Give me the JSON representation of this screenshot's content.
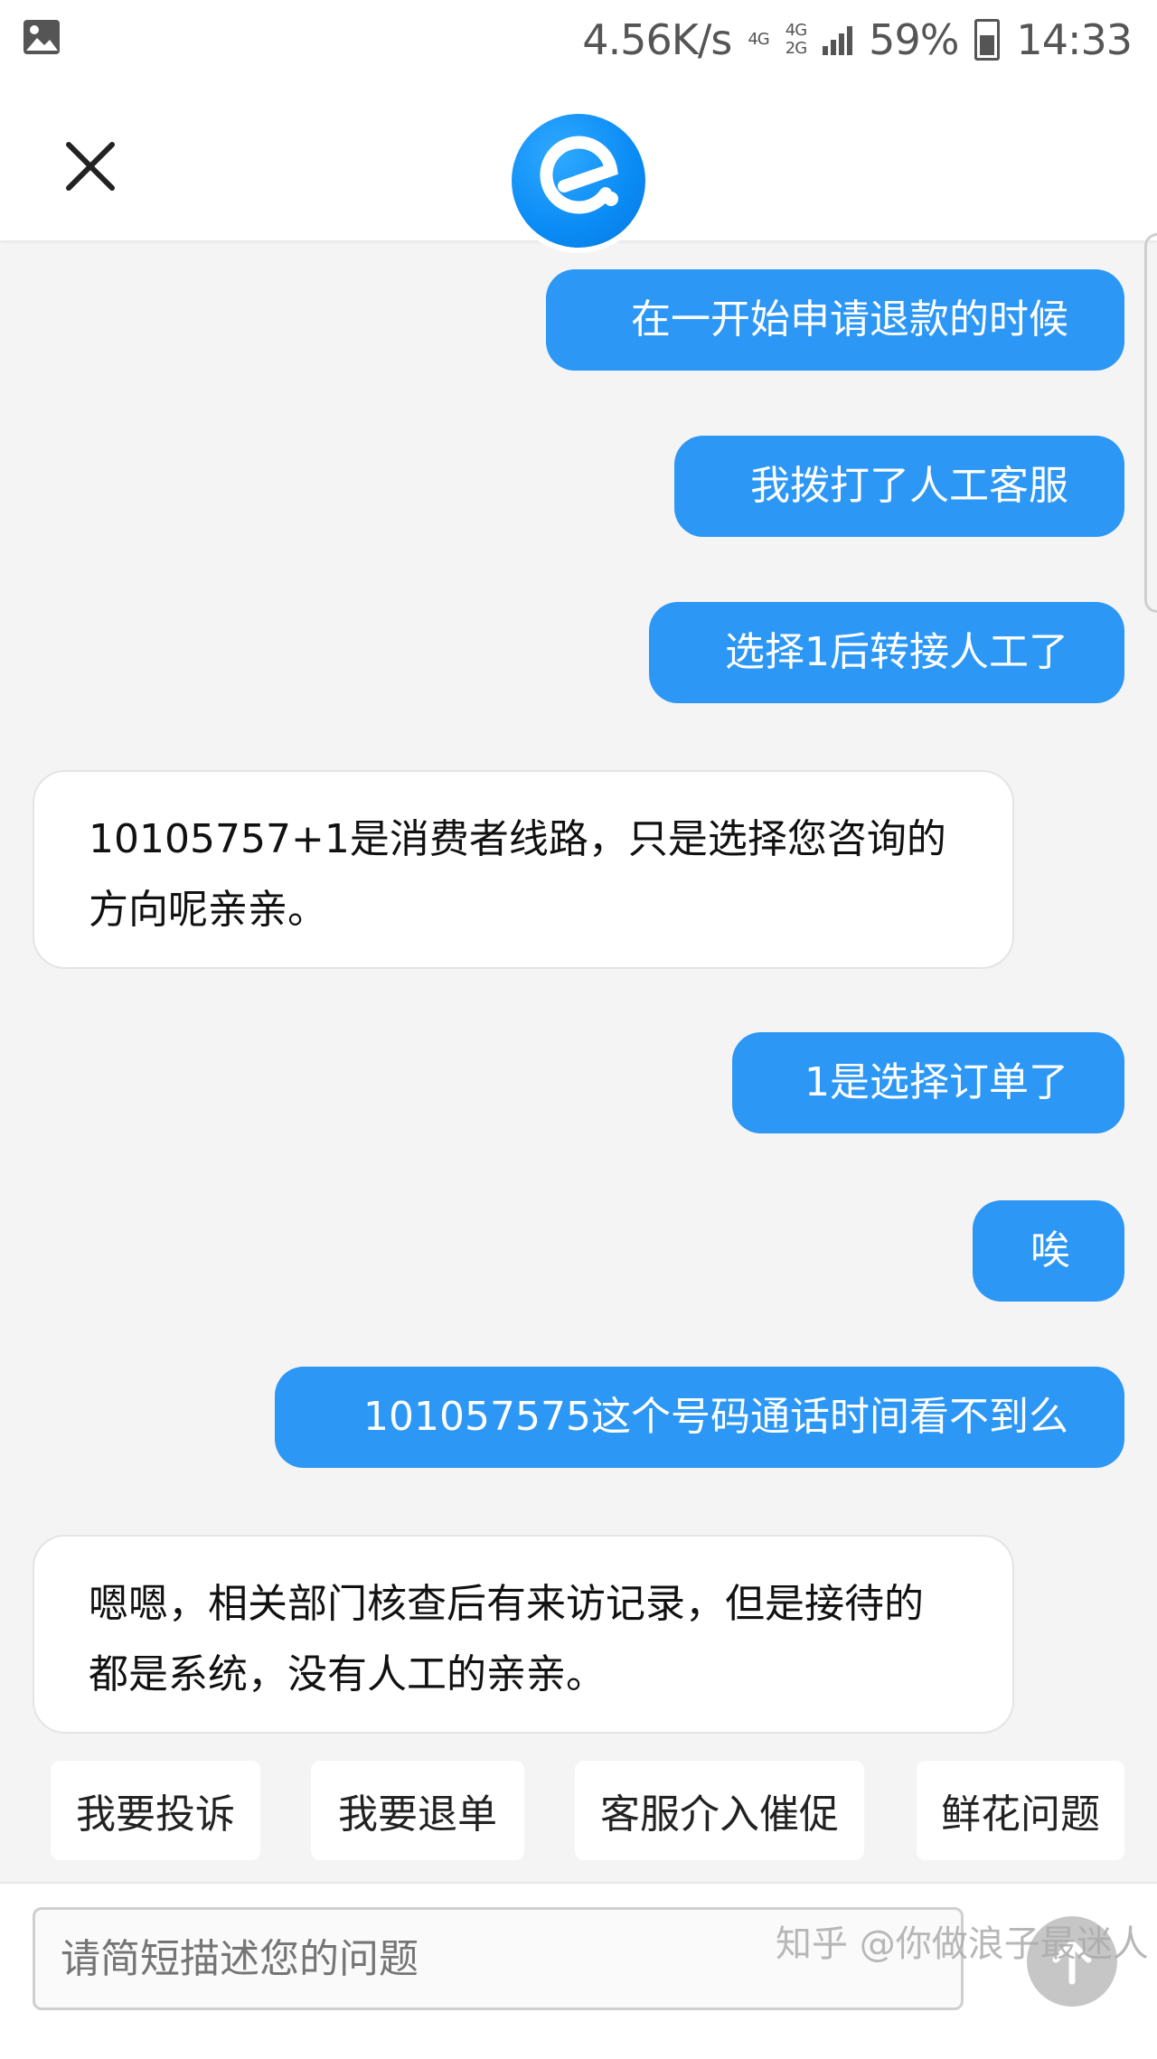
{
  "status_bar": {
    "speed": "4.56K/s",
    "net_top": "4G",
    "net_mid": "4G",
    "net_bottom": "2G",
    "battery": "59%",
    "time": "14:33",
    "left_icon": "image-icon"
  },
  "header": {
    "close_icon": "close-icon",
    "logo_icon": "eleme-logo-icon"
  },
  "messages": [
    {
      "side": "out",
      "text": "在一开始申请退款的时候"
    },
    {
      "side": "out",
      "text": "我拨打了人工客服"
    },
    {
      "side": "out",
      "text": "选择1后转接人工了"
    },
    {
      "side": "in",
      "text": "10105757+1是消费者线路，只是选择您咨询的方向呢亲亲。"
    },
    {
      "side": "out",
      "text": "1是选择订单了"
    },
    {
      "side": "out",
      "text": "唉"
    },
    {
      "side": "out",
      "text": "101057575这个号码通话时间看不到么"
    },
    {
      "side": "in",
      "text": "嗯嗯，相关部门核查后有来访记录，但是接待的都是系统，没有人工的亲亲。"
    }
  ],
  "quick_replies": [
    "我要投诉",
    "我要退单",
    "客服介入催促",
    "鲜花问题"
  ],
  "input": {
    "placeholder": "请简短描述您的问题",
    "value": "",
    "send_icon": "arrow-up-icon"
  },
  "watermark": "知乎 @你做浪子最迷人",
  "colors": {
    "accent": "#2c97f5",
    "background": "#f4f4f4",
    "send_button": "#c6c6c6"
  }
}
